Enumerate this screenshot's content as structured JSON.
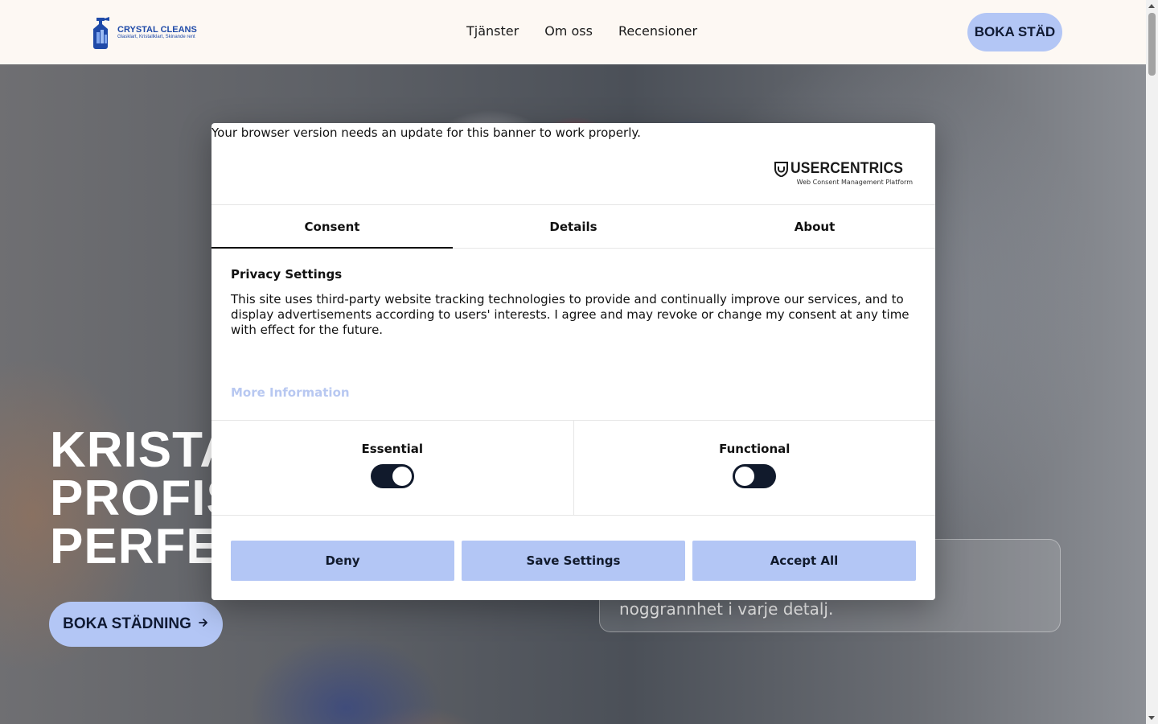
{
  "header": {
    "logo_name": "CRYSTAL CLEANS",
    "logo_tagline": "Glasklart, Kristallklart, Skinande rent",
    "nav": [
      {
        "label": "Tjänster"
      },
      {
        "label": "Om oss"
      },
      {
        "label": "Recensioner"
      }
    ],
    "cta_label": "BOKA STÄD"
  },
  "hero": {
    "title_visible": "KRISTAL\nPROFISS\nPERFEK",
    "cta_label": "BOKA STÄDNING",
    "card_text_visible": "n och\nter och\nnoggrannhet i varje detalj."
  },
  "consent": {
    "browser_note": "Your browser version needs an update for this banner to work properly.",
    "brand_name": "USERCENTRICS",
    "brand_sub": "Web Consent Management Platform",
    "tabs": [
      {
        "label": "Consent",
        "active": true
      },
      {
        "label": "Details",
        "active": false
      },
      {
        "label": "About",
        "active": false
      }
    ],
    "title": "Privacy Settings",
    "body": "This site uses third-party website tracking technologies to provide and continually improve our services, and to display advertisements according to users' interests. I agree and may revoke or change my consent at any time with effect for the future.",
    "more_info": "More Information",
    "toggles": [
      {
        "label": "Essential",
        "on": true
      },
      {
        "label": "Functional",
        "on": false
      }
    ],
    "buttons": {
      "deny": "Deny",
      "save": "Save Settings",
      "accept": "Accept All"
    }
  },
  "colors": {
    "accent": "#b3c6f5",
    "header_bg": "#fdf8f3",
    "switch_dark": "#111a2c",
    "link_light": "#b8c8f1"
  }
}
